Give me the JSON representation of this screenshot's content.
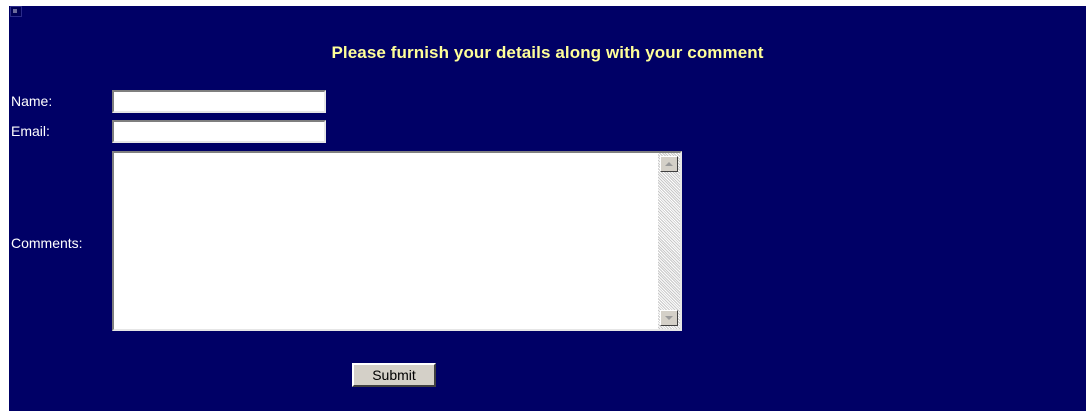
{
  "page": {
    "background_color": "#000066",
    "heading_color": "#ffff99"
  },
  "broken_image": {
    "icon": "broken-image-icon"
  },
  "form": {
    "heading": "Please furnish your details along with your comment",
    "name": {
      "label": "Name:",
      "value": ""
    },
    "email": {
      "label": "Email:",
      "value": ""
    },
    "comments": {
      "label": "Comments:",
      "value": ""
    },
    "submit_label": "Submit"
  },
  "scrollbar": {
    "up_icon": "arrow-up-icon",
    "down_icon": "arrow-down-icon"
  }
}
